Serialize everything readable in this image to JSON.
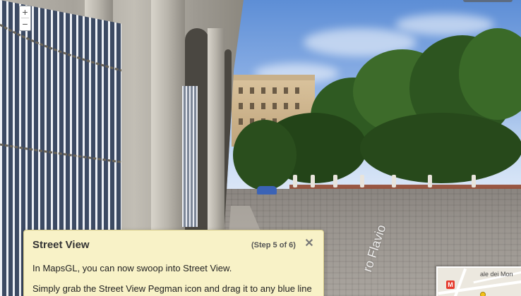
{
  "map_controls": {
    "zoom_in_label": "+",
    "zoom_out_label": "−"
  },
  "tour_panel": {
    "title": "Street View",
    "step": "(Step 5 of 6)",
    "close_label": "✕",
    "paragraph_1": "In MapsGL, you can now swoop into Street View.",
    "paragraph_2": "Simply grab the Street View Pegman icon and drag it to any blue line"
  },
  "street_label": "ro Flavio",
  "minimap": {
    "label": "ale dei Mon",
    "metro_badge": "M"
  },
  "colors": {
    "panel_background": "#f8f2c7",
    "panel_border": "#d6cb8c",
    "metro_red": "#e63b2e",
    "pegman_yellow": "#f5c21b"
  },
  "icons": {
    "zoom_in": "plus-icon",
    "zoom_out": "minus-icon",
    "close": "close-icon",
    "metro": "metro-icon",
    "pegman": "pegman-icon"
  }
}
